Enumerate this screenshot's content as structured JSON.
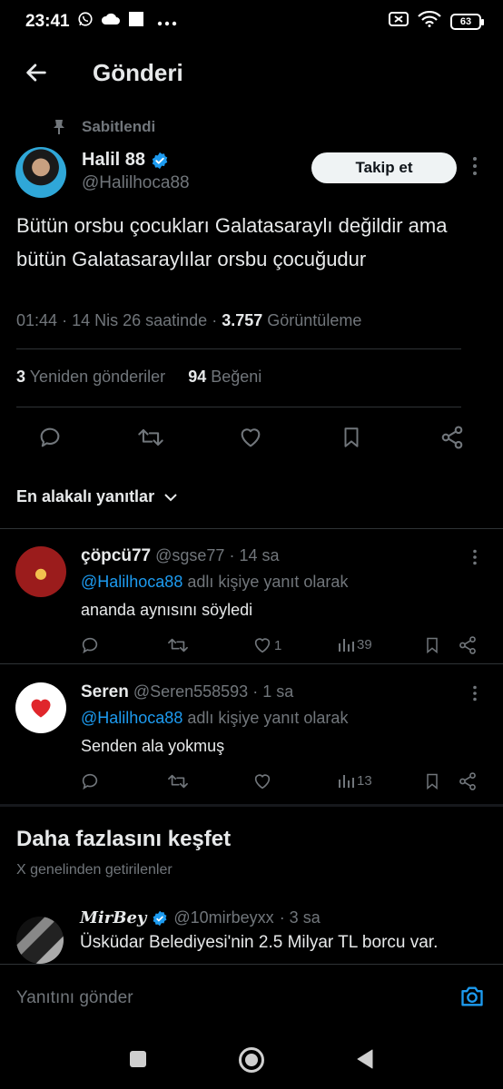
{
  "status": {
    "time": "23:41",
    "battery": "63",
    "icons_left": [
      "whatsapp-icon",
      "cloud-icon",
      "square-icon",
      "more-dots-icon"
    ],
    "icons_right": [
      "battery-saver-icon",
      "wifi-icon",
      "battery-icon"
    ]
  },
  "header": {
    "title": "Gönderi"
  },
  "pinned_label": "Sabitlendi",
  "tweet": {
    "author_name": "Halil 88",
    "handle": "@Halilhoca88",
    "follow_label": "Takip et",
    "text": "Bütün orsbu çocukları Galatasaraylı değildir ama bütün Galatasaraylılar orsbu çocuğudur",
    "time": "01:44",
    "date": "14 Nis 26 saatinde",
    "sep": "·",
    "views": "3.757",
    "views_label": "Görüntüleme",
    "reposts": "3",
    "reposts_label": "Yeniden gönderiler",
    "likes": "94",
    "likes_label": "Beğeni"
  },
  "sort_label": "En alakalı yanıtlar",
  "replies": [
    {
      "name": "çöpcü77",
      "handle": "@sgse77",
      "age": "· 14 sa",
      "mention": "@Halilhoca88",
      "reply_to_suffix": "adlı kişiye yanıt olarak",
      "text": "ananda aynısını söyledi",
      "likes": "1",
      "views": "39"
    },
    {
      "name": "Seren",
      "handle": "@Seren558593",
      "age": "· 1 sa",
      "mention": "@Halilhoca88",
      "reply_to_suffix": "adlı kişiye yanıt olarak",
      "text": "Senden ala yokmuş",
      "likes": "",
      "views": "13"
    }
  ],
  "explore": {
    "title": "Daha fazlasını keşfet",
    "subtitle": "X genelinden getirilenler",
    "item": {
      "name": "MirBey",
      "handle": "@10mirbeyxx",
      "age": "· 3 sa",
      "text": "Üsküdar Belediyesi'nin 2.5 Milyar TL borcu var."
    }
  },
  "composer": {
    "placeholder": "Yanıtını gönder"
  },
  "colors": {
    "accent": "#1d9bf0",
    "text": "#e7e9ea",
    "muted": "#71767b",
    "divider": "#2f3336"
  }
}
